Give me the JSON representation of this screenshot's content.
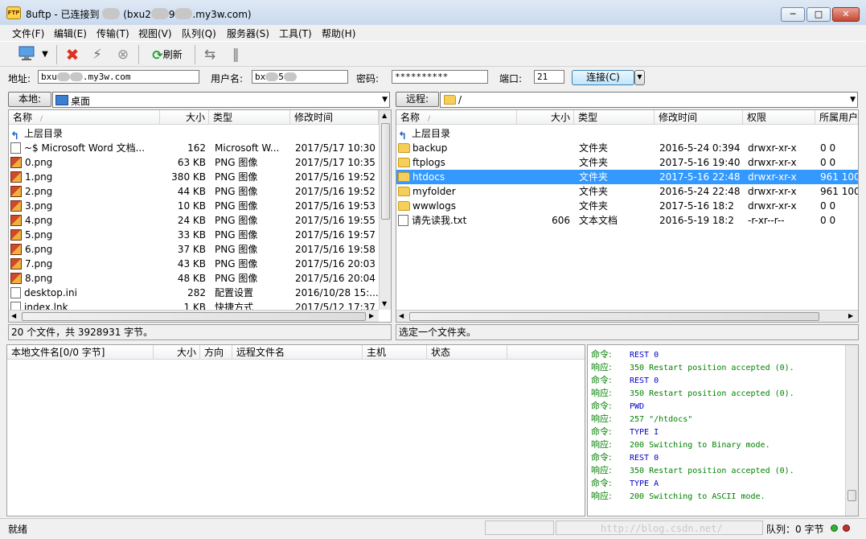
{
  "window": {
    "title_app": "8uftp - 已连接到",
    "title_host_mid": "(bxu2",
    "title_host_mid2": "9",
    "title_host_end": ".my3w.com)",
    "icon_label": "FTP",
    "minimize": "─",
    "maximize": "□",
    "close": "✕"
  },
  "menu": [
    {
      "label": "文件(F)"
    },
    {
      "label": "编辑(E)"
    },
    {
      "label": "传输(T)"
    },
    {
      "label": "视图(V)"
    },
    {
      "label": "队列(Q)"
    },
    {
      "label": "服务器(S)"
    },
    {
      "label": "工具(T)"
    },
    {
      "label": "帮助(H)"
    }
  ],
  "toolbar": {
    "refresh_label": "刷新",
    "icons": [
      "monitor-icon",
      "dropdown-arrow-icon",
      "disconnect-x-icon",
      "lightning-icon",
      "stop-icon",
      "refresh-icon",
      "transfer-icon",
      "pause-icon"
    ]
  },
  "connection": {
    "address_label": "地址:",
    "address_value_start": "bxu",
    "address_value_end": ".my3w.com",
    "username_label": "用户名:",
    "username_value_start": "bx",
    "username_value_mid": "5",
    "password_label": "密码:",
    "password_value": "**********",
    "port_label": "端口:",
    "port_value": "21",
    "connect_button": "连接(C)"
  },
  "local": {
    "location_label": "本地:",
    "location_value": "桌面",
    "columns": [
      "名称",
      "大小",
      "类型",
      "修改时间"
    ],
    "rows": [
      {
        "icon": "up",
        "name": "上层目录",
        "size": "",
        "type": "",
        "mtime": ""
      },
      {
        "icon": "file",
        "name": "~$ Microsoft Word 文档...",
        "size": "162",
        "type": "Microsoft W...",
        "mtime": "2017/5/17 10:30"
      },
      {
        "icon": "png",
        "name": "0.png",
        "size": "63 KB",
        "type": "PNG 图像",
        "mtime": "2017/5/17 10:35"
      },
      {
        "icon": "png",
        "name": "1.png",
        "size": "380 KB",
        "type": "PNG 图像",
        "mtime": "2017/5/16 19:52"
      },
      {
        "icon": "png",
        "name": "2.png",
        "size": "44 KB",
        "type": "PNG 图像",
        "mtime": "2017/5/16 19:52"
      },
      {
        "icon": "png",
        "name": "3.png",
        "size": "10 KB",
        "type": "PNG 图像",
        "mtime": "2017/5/16 19:53"
      },
      {
        "icon": "png",
        "name": "4.png",
        "size": "24 KB",
        "type": "PNG 图像",
        "mtime": "2017/5/16 19:55"
      },
      {
        "icon": "png",
        "name": "5.png",
        "size": "33 KB",
        "type": "PNG 图像",
        "mtime": "2017/5/16 19:57"
      },
      {
        "icon": "png",
        "name": "6.png",
        "size": "37 KB",
        "type": "PNG 图像",
        "mtime": "2017/5/16 19:58"
      },
      {
        "icon": "png",
        "name": "7.png",
        "size": "43 KB",
        "type": "PNG 图像",
        "mtime": "2017/5/16 20:03"
      },
      {
        "icon": "png",
        "name": "8.png",
        "size": "48 KB",
        "type": "PNG 图像",
        "mtime": "2017/5/16 20:04"
      },
      {
        "icon": "file",
        "name": "desktop.ini",
        "size": "282",
        "type": "配置设置",
        "mtime": "2016/10/28 15:..."
      },
      {
        "icon": "file",
        "name": "index.lnk",
        "size": "1 KB",
        "type": "快捷方式",
        "mtime": "2017/5/12 17:37"
      }
    ],
    "status": "20 个文件，共 3928931 字节。"
  },
  "remote": {
    "location_label": "远程:",
    "location_value": "/",
    "columns": [
      "名称",
      "大小",
      "类型",
      "修改时间",
      "权限",
      "所属用户"
    ],
    "rows": [
      {
        "icon": "up",
        "name": "上层目录",
        "size": "",
        "type": "",
        "mtime": "",
        "perm": "",
        "owner": ""
      },
      {
        "icon": "folder",
        "name": "backup",
        "size": "",
        "type": "文件夹",
        "mtime": "2016-5-24 0:394",
        "perm": "drwxr-xr-x",
        "owner": "0 0"
      },
      {
        "icon": "folder",
        "name": "ftplogs",
        "size": "",
        "type": "文件夹",
        "mtime": "2017-5-16 19:40",
        "perm": "drwxr-xr-x",
        "owner": "0 0"
      },
      {
        "icon": "folder",
        "name": "htdocs",
        "size": "",
        "type": "文件夹",
        "mtime": "2017-5-16 22:48",
        "perm": "drwxr-xr-x",
        "owner": "961 100",
        "selected": true
      },
      {
        "icon": "folder",
        "name": "myfolder",
        "size": "",
        "type": "文件夹",
        "mtime": "2016-5-24 22:48",
        "perm": "drwxr-xr-x",
        "owner": "961 100"
      },
      {
        "icon": "folder",
        "name": "wwwlogs",
        "size": "",
        "type": "文件夹",
        "mtime": "2017-5-16 18:2",
        "perm": "drwxr-xr-x",
        "owner": "0 0"
      },
      {
        "icon": "file",
        "name": "请先读我.txt",
        "size": "606",
        "type": "文本文档",
        "mtime": "2016-5-19 18:2",
        "perm": "-r-xr--r--",
        "owner": "0 0"
      }
    ],
    "status": "选定一个文件夹。"
  },
  "queue": {
    "columns": [
      "本地文件名[0/0 字节]",
      "大小",
      "方向",
      "远程文件名",
      "主机",
      "状态"
    ]
  },
  "log": [
    {
      "kind": "命令:",
      "text": "REST 0",
      "type": "cmd"
    },
    {
      "kind": "响应:",
      "text": "350 Restart position accepted (0).",
      "type": "resp"
    },
    {
      "kind": "命令:",
      "text": "REST 0",
      "type": "cmd"
    },
    {
      "kind": "响应:",
      "text": "350 Restart position accepted (0).",
      "type": "resp"
    },
    {
      "kind": "命令:",
      "text": "PWD",
      "type": "cmd"
    },
    {
      "kind": "响应:",
      "text": "257 \"/htdocs\"",
      "type": "resp"
    },
    {
      "kind": "命令:",
      "text": "TYPE I",
      "type": "cmd"
    },
    {
      "kind": "响应:",
      "text": "200 Switching to Binary mode.",
      "type": "resp"
    },
    {
      "kind": "命令:",
      "text": "REST 0",
      "type": "cmd"
    },
    {
      "kind": "响应:",
      "text": "350 Restart position accepted (0).",
      "type": "resp"
    },
    {
      "kind": "命令:",
      "text": "TYPE A",
      "type": "cmd"
    },
    {
      "kind": "响应:",
      "text": "200 Switching to ASCII mode.",
      "type": "resp"
    }
  ],
  "statusbar": {
    "left": "就绪",
    "watermark": "http://blog.csdn.net/",
    "queue": "队列：0 字节"
  }
}
